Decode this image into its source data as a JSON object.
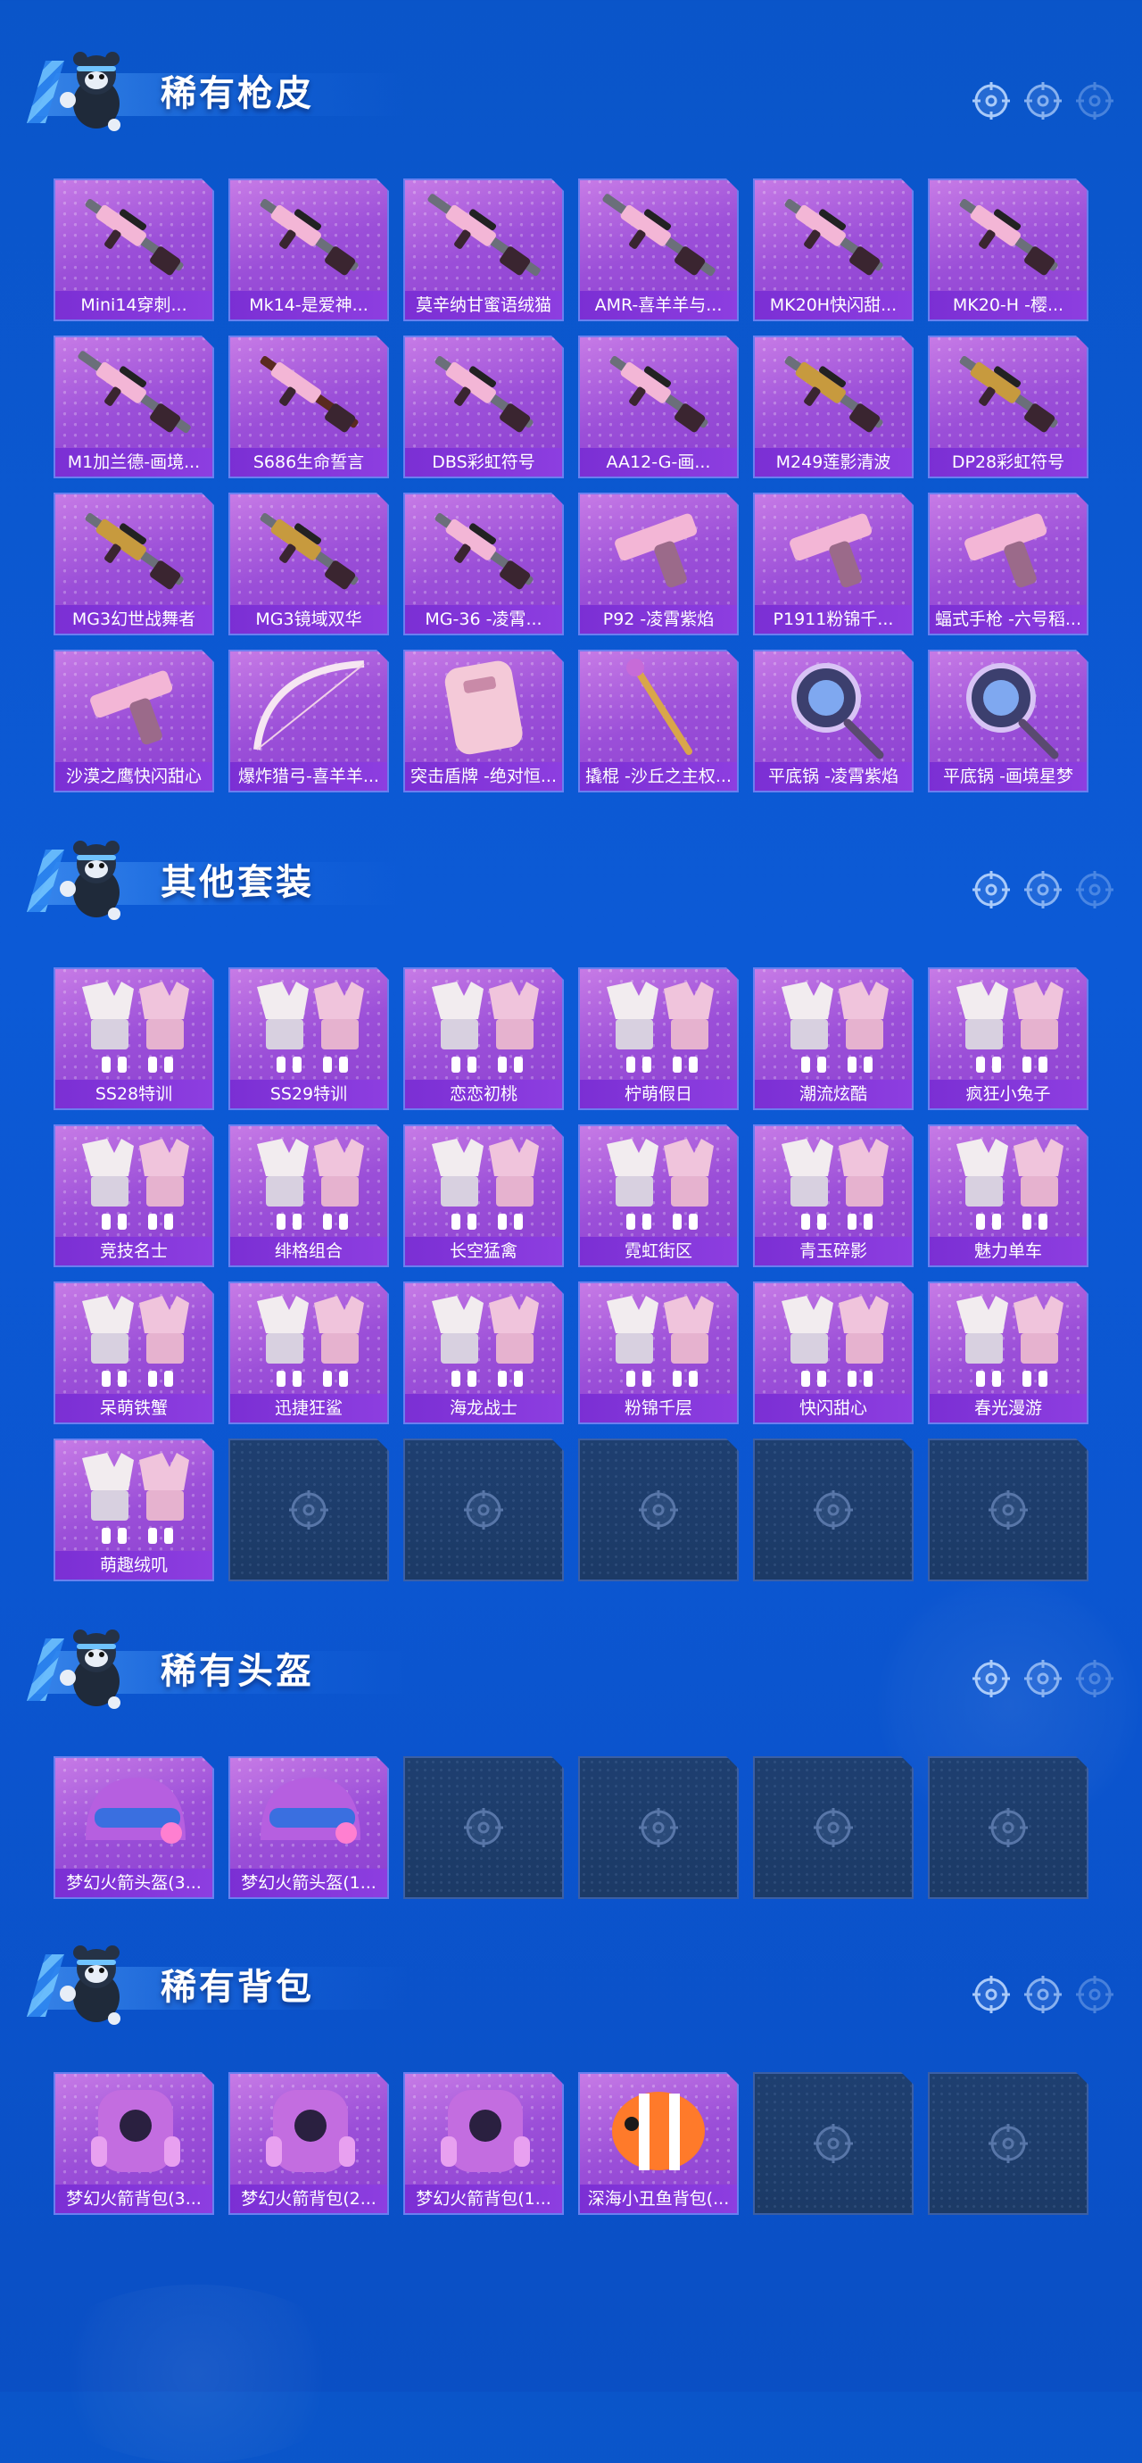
{
  "sections": [
    {
      "title": "稀有枪皮",
      "items": [
        {
          "label": "Mini14穿刺...",
          "art": "rifle"
        },
        {
          "label": "Mk14-是爱神...",
          "art": "rifle"
        },
        {
          "label": "莫辛纳甘蜜语绒猫",
          "art": "sniper"
        },
        {
          "label": "AMR-喜羊羊与...",
          "art": "sniper"
        },
        {
          "label": "MK20H快闪甜...",
          "art": "rifle"
        },
        {
          "label": "MK20-H -樱...",
          "art": "rifle"
        },
        {
          "label": "M1加兰德-画境...",
          "art": "sniper"
        },
        {
          "label": "S686生命誓言",
          "art": "shotgun"
        },
        {
          "label": "DBS彩虹符号",
          "art": "rifle"
        },
        {
          "label": "AA12-G-画...",
          "art": "rifle"
        },
        {
          "label": "M249莲影清波",
          "art": "lmg"
        },
        {
          "label": "DP28彩虹符号",
          "art": "lmg"
        },
        {
          "label": "MG3幻世战舞者",
          "art": "lmg"
        },
        {
          "label": "MG3镜域双华",
          "art": "lmg"
        },
        {
          "label": "MG-36 -凌霄...",
          "art": "rifle"
        },
        {
          "label": "P92 -凌霄紫焰",
          "art": "pistol"
        },
        {
          "label": "P1911粉锦千...",
          "art": "pistol"
        },
        {
          "label": "蝠式手枪 -六号稻...",
          "art": "pistol"
        },
        {
          "label": "沙漠之鹰快闪甜心",
          "art": "pistol"
        },
        {
          "label": "爆炸猎弓-喜羊羊...",
          "art": "bow"
        },
        {
          "label": "突击盾牌 -绝对恒...",
          "art": "shield"
        },
        {
          "label": "撬棍 -沙丘之主权...",
          "art": "crowbar"
        },
        {
          "label": "平底锅 -凌霄紫焰",
          "art": "pan"
        },
        {
          "label": "平底锅 -画境星梦",
          "art": "pan"
        }
      ],
      "empty_slots": 0
    },
    {
      "title": "其他套装",
      "items": [
        {
          "label": "SS28特训",
          "art": "outfit"
        },
        {
          "label": "SS29特训",
          "art": "outfit"
        },
        {
          "label": "恋恋初桃",
          "art": "outfit"
        },
        {
          "label": "柠萌假日",
          "art": "outfit"
        },
        {
          "label": "潮流炫酷",
          "art": "outfit"
        },
        {
          "label": "疯狂小兔子",
          "art": "outfit"
        },
        {
          "label": "竞技名士",
          "art": "outfit"
        },
        {
          "label": "绯格组合",
          "art": "outfit"
        },
        {
          "label": "长空猛禽",
          "art": "outfit"
        },
        {
          "label": "霓虹街区",
          "art": "outfit"
        },
        {
          "label": "青玉碎影",
          "art": "outfit"
        },
        {
          "label": "魅力单车",
          "art": "outfit"
        },
        {
          "label": "呆萌铁蟹",
          "art": "outfit"
        },
        {
          "label": "迅捷狂鲨",
          "art": "outfit"
        },
        {
          "label": "海龙战士",
          "art": "outfit"
        },
        {
          "label": "粉锦千层",
          "art": "outfit"
        },
        {
          "label": "快闪甜心",
          "art": "outfit"
        },
        {
          "label": "春光漫游",
          "art": "outfit"
        },
        {
          "label": "萌趣绒叽",
          "art": "outfit"
        }
      ],
      "empty_slots": 5
    },
    {
      "title": "稀有头盔",
      "items": [
        {
          "label": "梦幻火箭头盔(3...",
          "art": "helmet"
        },
        {
          "label": "梦幻火箭头盔(1...",
          "art": "helmet"
        }
      ],
      "empty_slots": 4
    },
    {
      "title": "稀有背包",
      "items": [
        {
          "label": "梦幻火箭背包(3...",
          "art": "backpack"
        },
        {
          "label": "梦幻火箭背包(2...",
          "art": "backpack"
        },
        {
          "label": "梦幻火箭背包(1...",
          "art": "backpack"
        },
        {
          "label": "深海小丑鱼背包(...",
          "art": "backpack-fish"
        }
      ],
      "empty_slots": 2
    }
  ],
  "colors": {
    "background": "#0b55cf",
    "card_purple": "#9b4fd8",
    "label_purple": "#7b2fd4",
    "empty_slot": "#1e3f70"
  }
}
